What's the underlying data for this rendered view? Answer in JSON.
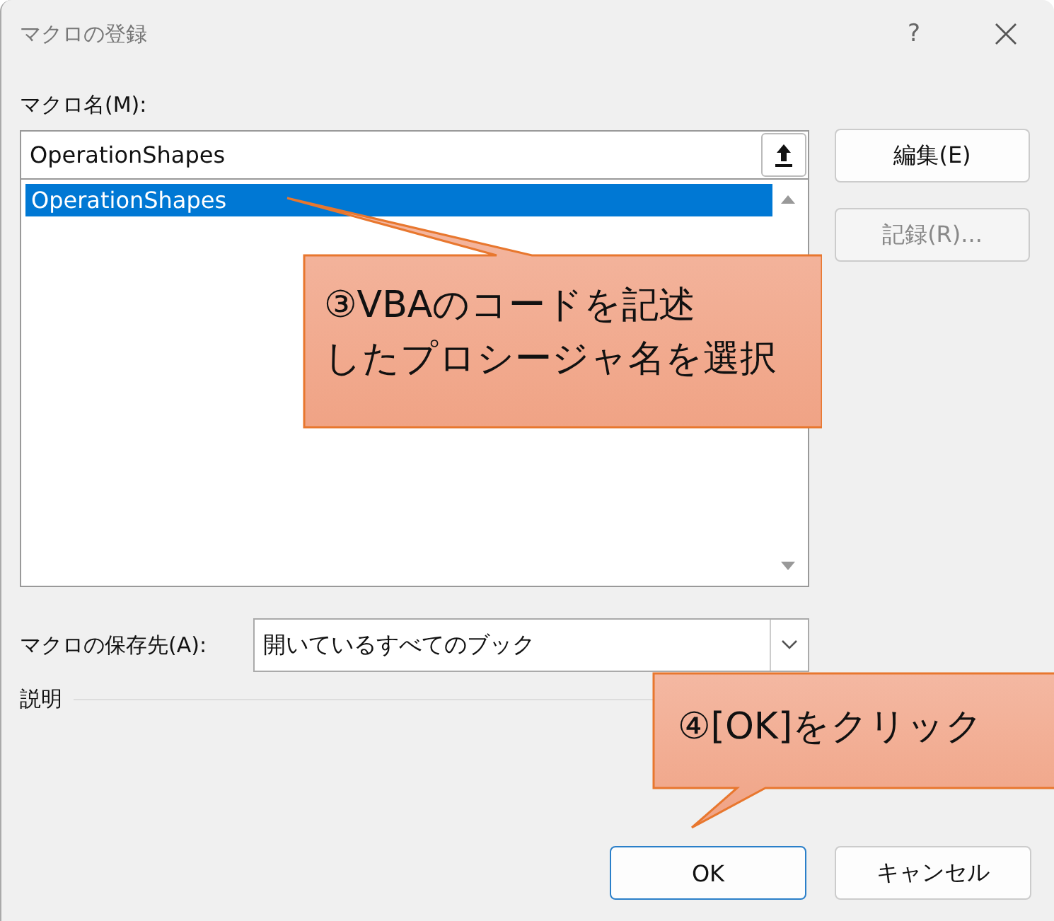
{
  "window": {
    "title": "マクロの登録",
    "help": "?"
  },
  "macro_name": {
    "label": "マクロ名(M):",
    "value": "OperationShapes"
  },
  "macro_list": {
    "items": [
      {
        "name": "OperationShapes",
        "selected": true
      }
    ]
  },
  "buttons": [
    {
      "label": "編集(E)",
      "disabled": false
    },
    {
      "label": "記録(R)...",
      "disabled": true
    }
  ],
  "store": {
    "label": "マクロの保存先(A):",
    "value": "開いているすべてのブック"
  },
  "description": {
    "label": "説明"
  },
  "footer_buttons": [
    {
      "label": "OK",
      "default": true
    },
    {
      "label": "キャンセル",
      "default": false
    }
  ],
  "callouts": [
    {
      "lines": [
        "③VBAのコードを記述",
        "したプロシージャ名を選択"
      ]
    },
    {
      "lines": [
        "④[OK]をクリック"
      ]
    }
  ]
}
